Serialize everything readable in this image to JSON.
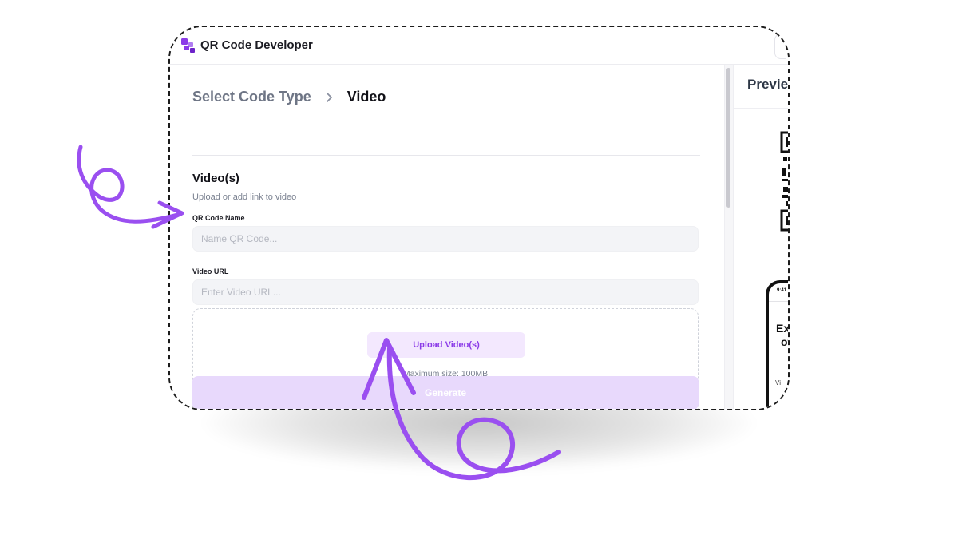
{
  "colors": {
    "accent": "#8b3be8",
    "accent_light": "#f3e8fe",
    "generate_bg": "#e8d9fc",
    "arrow": "#9a4ff0"
  },
  "header": {
    "app_title": "QR Code Developer",
    "logo_icon": "qr-logo-icon"
  },
  "breadcrumb": {
    "step_1": "Select Code Type",
    "separator_icon": "chevron-right-icon",
    "step_2": "Video"
  },
  "form": {
    "section_title": "Video(s)",
    "section_subtitle": "Upload or add link to video",
    "name_label": "QR Code Name",
    "name_placeholder": "Name QR Code...",
    "url_label": "Video URL",
    "url_placeholder": "Enter Video URL...",
    "upload_button": "Upload Video(s)",
    "max_size": "Maximum size: 100MB",
    "generate_button": "Generate"
  },
  "preview": {
    "title": "Previe",
    "phone_time": "9:41",
    "phone_text_1": "Exp",
    "phone_text_2": "of",
    "phone_text_3": "Vi"
  }
}
